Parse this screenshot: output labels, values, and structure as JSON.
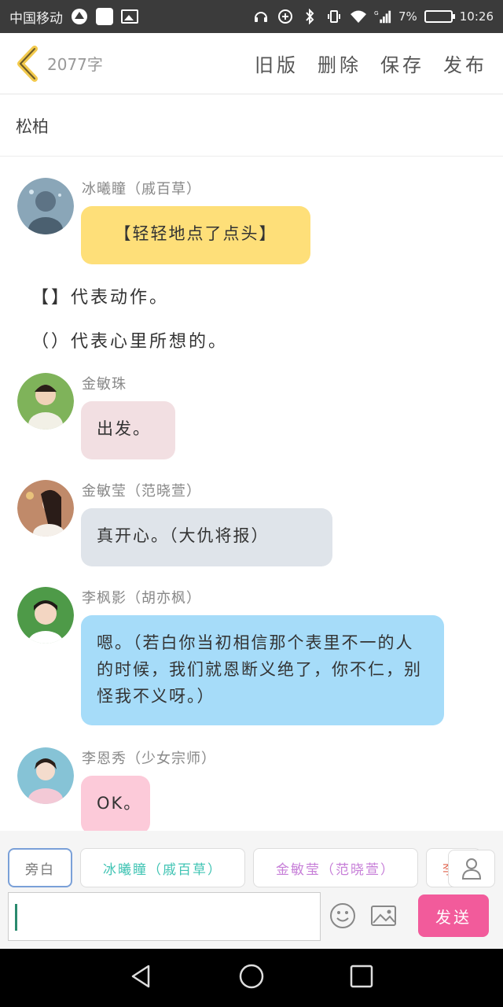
{
  "statusbar": {
    "carrier": "中国移动",
    "signal": "G",
    "battery": "7%",
    "time": "10:26"
  },
  "header": {
    "word_count": "2077字",
    "actions": [
      "旧版",
      "删除",
      "保存",
      "发布"
    ]
  },
  "title": "松柏",
  "messages": [
    {
      "name": "冰曦瞳（戚百草）",
      "text": "【轻轻地点了点头】",
      "bubble_color": "#fedf79",
      "avatar_color": "#6d8aa1"
    },
    {
      "name": "金敏珠",
      "text": "出发。",
      "bubble_color": "#f2dfe2",
      "avatar_color": "#5fa14a"
    },
    {
      "name": "金敏莹（范晓萱）",
      "text": "真开心。（大仇将报）",
      "bubble_color": "#dfe4ea",
      "avatar_color": "#a8634c"
    },
    {
      "name": "李枫影（胡亦枫）",
      "text": "嗯。（若白你当初相信那个表里不一的人的时候，我们就恩断义绝了，你不仁，别怪我不义呀。）",
      "bubble_color": "#a6dcf9",
      "avatar_color": "#3f8a3a"
    },
    {
      "name": "李恩秀（少女宗师）",
      "text": "OK。",
      "bubble_color": "#fccad9",
      "avatar_color": "#6bb0c8"
    }
  ],
  "narration": [
    "【】代表动作。",
    "（）代表心里所想的。"
  ],
  "chips": [
    {
      "label": "旁白",
      "color": "#777777"
    },
    {
      "label": "冰曦瞳（戚百草）",
      "color": "#41c4b4"
    },
    {
      "label": "金敏莹（范晓萱）",
      "color": "#c77fd8"
    },
    {
      "label": "李",
      "color": "#e0604a"
    }
  ],
  "input": {
    "value": ""
  },
  "send_label": "发送",
  "colors": {
    "accent_back": "#f2c94c",
    "send_bg": "#f25b9b"
  }
}
